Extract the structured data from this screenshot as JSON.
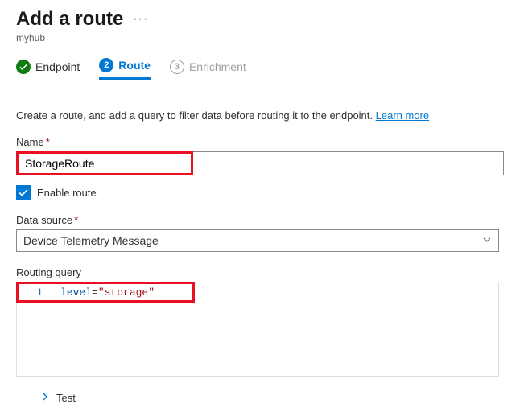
{
  "header": {
    "title": "Add a route",
    "subtitle": "myhub"
  },
  "stepper": {
    "step1_label": "Endpoint",
    "step2_num": "2",
    "step2_label": "Route",
    "step3_num": "3",
    "step3_label": "Enrichment"
  },
  "intro": {
    "text": "Create a route, and add a query to filter data before routing it to the endpoint. ",
    "learn_more": "Learn more"
  },
  "form": {
    "name_label": "Name",
    "name_value": "StorageRoute",
    "enable_label": "Enable route",
    "data_source_label": "Data source",
    "data_source_value": "Device Telemetry Message",
    "query_label": "Routing query",
    "query_line_no": "1",
    "query_key": "level",
    "query_eq": "=",
    "query_val": "\"storage\"",
    "test_label": "Test"
  }
}
